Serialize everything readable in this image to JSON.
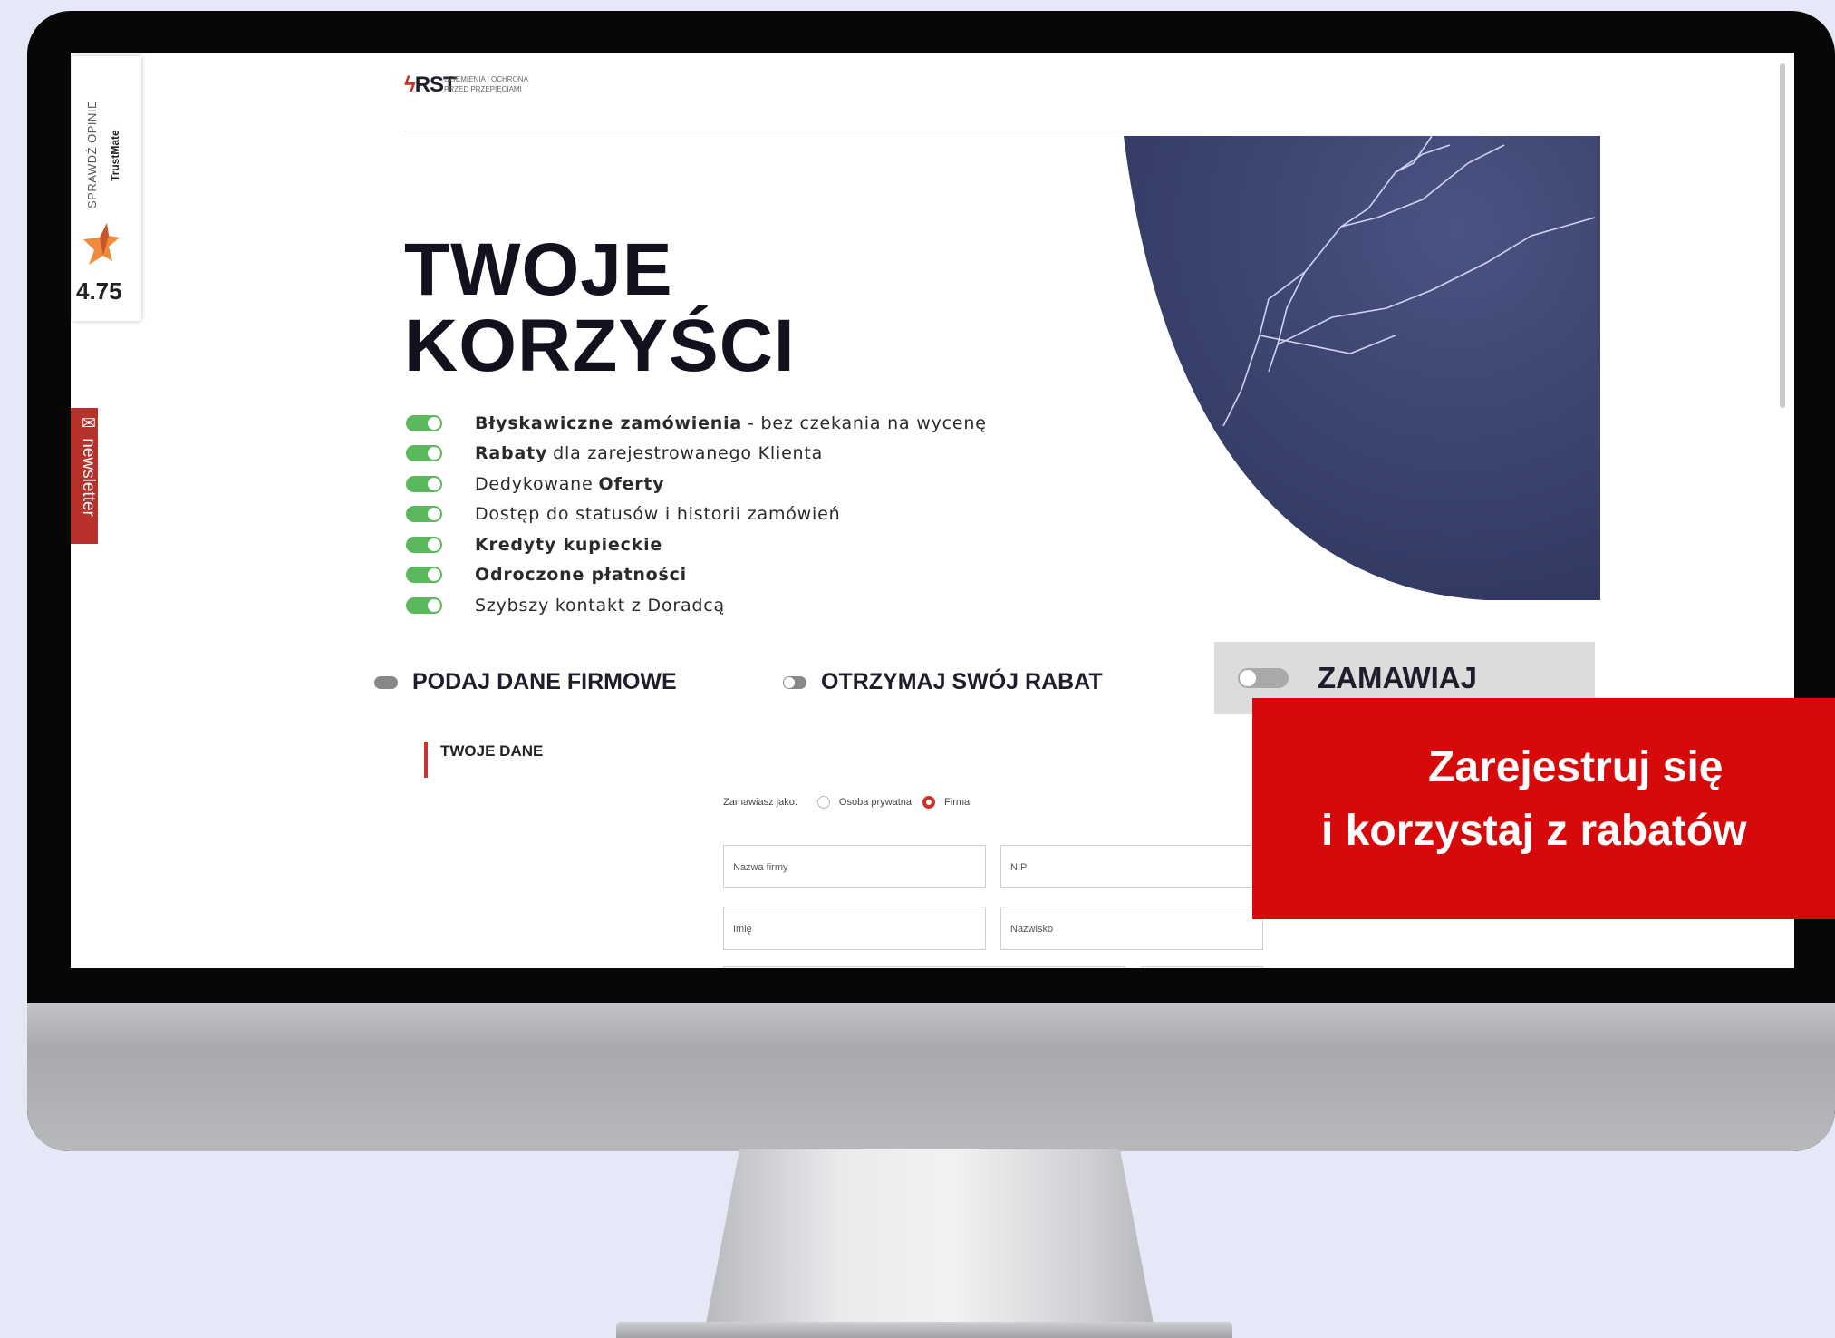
{
  "trustmate": {
    "check": "SPRAWDŹ OPINIE",
    "brand": "TrustMate",
    "score": "4.75"
  },
  "newsletter": "newsletter",
  "logo": {
    "name": "RST",
    "tagline_1": "UZIEMIENIA I OCHRONA",
    "tagline_2": "PRZED PRZEPIĘCIAMI"
  },
  "hero": {
    "title_1": "TWOJE",
    "title_2": "KORZYŚCI"
  },
  "benefits": [
    {
      "bold": "Błyskawiczne zamówienia",
      "rest": "- bez czekania na wycenę"
    },
    {
      "bold": "Rabaty",
      "rest": "dla zarejestrowanego Klienta"
    },
    {
      "pre": "Dedykowane",
      "bold": "Oferty"
    },
    {
      "rest": "Dostęp do statusów i historii zamówień"
    },
    {
      "bold": "Kredyty kupieckie"
    },
    {
      "bold": "Odroczone płatności"
    },
    {
      "rest": "Szybszy kontakt z Doradcą"
    }
  ],
  "steps": [
    "PODAJ DANE FIRMOWE",
    "OTRZYMAJ SWÓJ RABAT",
    "ZAMAWIAJ"
  ],
  "form": {
    "section": "TWOJE DANE",
    "order_as": "Zamawiasz jako:",
    "option_private": "Osoba prywatna",
    "option_company": "Firma",
    "company_name": "Nazwa firmy",
    "nip": "NIP",
    "first_name": "Imię",
    "last_name": "Nazwisko"
  },
  "banner": {
    "line1": "Zarejestruj się",
    "line2": "i korzystaj z rabatów"
  },
  "colors": {
    "accent": "#c8332b",
    "toggle_on": "#5cb85c",
    "banner": "#d60a0a",
    "background": "#e6e8f7"
  }
}
